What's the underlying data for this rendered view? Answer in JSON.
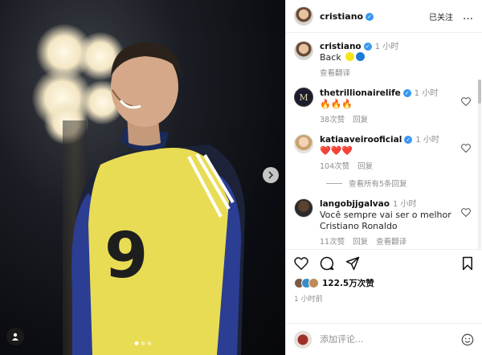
{
  "post": {
    "author": "cristiano",
    "follow_label": "已关注",
    "more_label": "…"
  },
  "photo": {
    "jersey_number": "9"
  },
  "comments": [
    {
      "user": "cristiano",
      "time": "1 小时",
      "text": "Back",
      "emojis": [
        "#f4e61a",
        "#1c7bd6"
      ],
      "meta": [
        "查看翻译"
      ],
      "verified": true
    },
    {
      "user": "thetrillionairelife",
      "time": "1 小时",
      "text": "🔥🔥🔥",
      "meta": [
        "38次赞",
        "回复"
      ],
      "verified": true,
      "avatar_letter": "M"
    },
    {
      "user": "katiaaveirooficial",
      "time": "1 小时",
      "text": "❤️❤️❤️",
      "meta": [
        "104次赞",
        "回复"
      ],
      "verified": true
    },
    {
      "user": "langobjjgalvao",
      "time": "1 小时",
      "text": "Você sempre vai ser o melhor Cristiano Ronaldo",
      "meta": [
        "11次赞",
        "回复",
        "查看翻译"
      ],
      "verified": false
    }
  ],
  "view_replies_label": "查看所有5条回复",
  "actions": {
    "likes_label": "122.5万次赞",
    "posted_time": "1 小时前"
  },
  "add_comment": {
    "placeholder": "添加评论..."
  },
  "colors": {
    "verified": "#3897f0",
    "jersey": "#e9dc55",
    "sleeve": "#2b3e93"
  },
  "icons": [
    "heart-icon",
    "comment-icon",
    "share-icon",
    "bookmark-icon",
    "emoji-icon",
    "chevron-right-icon",
    "user-tag-icon",
    "more-icon"
  ]
}
